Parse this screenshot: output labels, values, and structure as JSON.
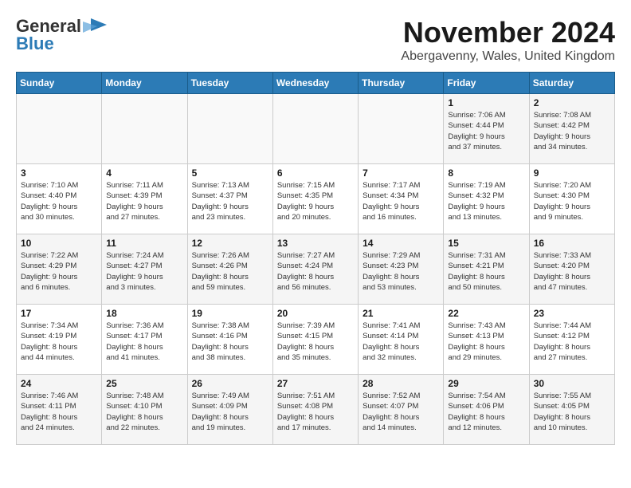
{
  "logo": {
    "general": "General",
    "blue": "Blue"
  },
  "header": {
    "month_title": "November 2024",
    "subtitle": "Abergavenny, Wales, United Kingdom"
  },
  "weekdays": [
    "Sunday",
    "Monday",
    "Tuesday",
    "Wednesday",
    "Thursday",
    "Friday",
    "Saturday"
  ],
  "weeks": [
    [
      {
        "day": "",
        "info": ""
      },
      {
        "day": "",
        "info": ""
      },
      {
        "day": "",
        "info": ""
      },
      {
        "day": "",
        "info": ""
      },
      {
        "day": "",
        "info": ""
      },
      {
        "day": "1",
        "info": "Sunrise: 7:06 AM\nSunset: 4:44 PM\nDaylight: 9 hours\nand 37 minutes."
      },
      {
        "day": "2",
        "info": "Sunrise: 7:08 AM\nSunset: 4:42 PM\nDaylight: 9 hours\nand 34 minutes."
      }
    ],
    [
      {
        "day": "3",
        "info": "Sunrise: 7:10 AM\nSunset: 4:40 PM\nDaylight: 9 hours\nand 30 minutes."
      },
      {
        "day": "4",
        "info": "Sunrise: 7:11 AM\nSunset: 4:39 PM\nDaylight: 9 hours\nand 27 minutes."
      },
      {
        "day": "5",
        "info": "Sunrise: 7:13 AM\nSunset: 4:37 PM\nDaylight: 9 hours\nand 23 minutes."
      },
      {
        "day": "6",
        "info": "Sunrise: 7:15 AM\nSunset: 4:35 PM\nDaylight: 9 hours\nand 20 minutes."
      },
      {
        "day": "7",
        "info": "Sunrise: 7:17 AM\nSunset: 4:34 PM\nDaylight: 9 hours\nand 16 minutes."
      },
      {
        "day": "8",
        "info": "Sunrise: 7:19 AM\nSunset: 4:32 PM\nDaylight: 9 hours\nand 13 minutes."
      },
      {
        "day": "9",
        "info": "Sunrise: 7:20 AM\nSunset: 4:30 PM\nDaylight: 9 hours\nand 9 minutes."
      }
    ],
    [
      {
        "day": "10",
        "info": "Sunrise: 7:22 AM\nSunset: 4:29 PM\nDaylight: 9 hours\nand 6 minutes."
      },
      {
        "day": "11",
        "info": "Sunrise: 7:24 AM\nSunset: 4:27 PM\nDaylight: 9 hours\nand 3 minutes."
      },
      {
        "day": "12",
        "info": "Sunrise: 7:26 AM\nSunset: 4:26 PM\nDaylight: 8 hours\nand 59 minutes."
      },
      {
        "day": "13",
        "info": "Sunrise: 7:27 AM\nSunset: 4:24 PM\nDaylight: 8 hours\nand 56 minutes."
      },
      {
        "day": "14",
        "info": "Sunrise: 7:29 AM\nSunset: 4:23 PM\nDaylight: 8 hours\nand 53 minutes."
      },
      {
        "day": "15",
        "info": "Sunrise: 7:31 AM\nSunset: 4:21 PM\nDaylight: 8 hours\nand 50 minutes."
      },
      {
        "day": "16",
        "info": "Sunrise: 7:33 AM\nSunset: 4:20 PM\nDaylight: 8 hours\nand 47 minutes."
      }
    ],
    [
      {
        "day": "17",
        "info": "Sunrise: 7:34 AM\nSunset: 4:19 PM\nDaylight: 8 hours\nand 44 minutes."
      },
      {
        "day": "18",
        "info": "Sunrise: 7:36 AM\nSunset: 4:17 PM\nDaylight: 8 hours\nand 41 minutes."
      },
      {
        "day": "19",
        "info": "Sunrise: 7:38 AM\nSunset: 4:16 PM\nDaylight: 8 hours\nand 38 minutes."
      },
      {
        "day": "20",
        "info": "Sunrise: 7:39 AM\nSunset: 4:15 PM\nDaylight: 8 hours\nand 35 minutes."
      },
      {
        "day": "21",
        "info": "Sunrise: 7:41 AM\nSunset: 4:14 PM\nDaylight: 8 hours\nand 32 minutes."
      },
      {
        "day": "22",
        "info": "Sunrise: 7:43 AM\nSunset: 4:13 PM\nDaylight: 8 hours\nand 29 minutes."
      },
      {
        "day": "23",
        "info": "Sunrise: 7:44 AM\nSunset: 4:12 PM\nDaylight: 8 hours\nand 27 minutes."
      }
    ],
    [
      {
        "day": "24",
        "info": "Sunrise: 7:46 AM\nSunset: 4:11 PM\nDaylight: 8 hours\nand 24 minutes."
      },
      {
        "day": "25",
        "info": "Sunrise: 7:48 AM\nSunset: 4:10 PM\nDaylight: 8 hours\nand 22 minutes."
      },
      {
        "day": "26",
        "info": "Sunrise: 7:49 AM\nSunset: 4:09 PM\nDaylight: 8 hours\nand 19 minutes."
      },
      {
        "day": "27",
        "info": "Sunrise: 7:51 AM\nSunset: 4:08 PM\nDaylight: 8 hours\nand 17 minutes."
      },
      {
        "day": "28",
        "info": "Sunrise: 7:52 AM\nSunset: 4:07 PM\nDaylight: 8 hours\nand 14 minutes."
      },
      {
        "day": "29",
        "info": "Sunrise: 7:54 AM\nSunset: 4:06 PM\nDaylight: 8 hours\nand 12 minutes."
      },
      {
        "day": "30",
        "info": "Sunrise: 7:55 AM\nSunset: 4:05 PM\nDaylight: 8 hours\nand 10 minutes."
      }
    ]
  ]
}
